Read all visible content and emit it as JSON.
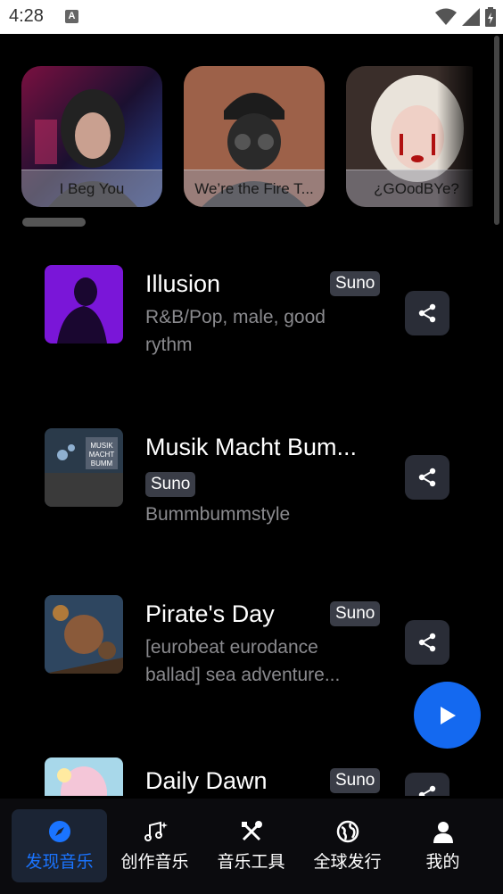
{
  "status_bar": {
    "time": "4:28",
    "notification_icon": "A"
  },
  "carousel": {
    "cards": [
      {
        "title": "I Beg You"
      },
      {
        "title": "We’re the Fire T..."
      },
      {
        "title": "¿GOodBYe?"
      }
    ]
  },
  "songs": [
    {
      "title": "Illusion",
      "badge": "Suno",
      "desc": "R&B/Pop, male, good rythm"
    },
    {
      "title": "Musik Macht Bum...",
      "badge": "Suno",
      "desc": "Bummbummstyle",
      "thumb_text": "MUSIK MACHT BUMM"
    },
    {
      "title": "Pirate's Day",
      "badge": "Suno",
      "desc": "[eurobeat eurodance ballad] sea adventure..."
    },
    {
      "title": "Daily Dawn",
      "badge": "Suno",
      "desc": ""
    }
  ],
  "nav": {
    "items": [
      {
        "label": "发现音乐",
        "icon": "compass-icon"
      },
      {
        "label": "创作音乐",
        "icon": "music-note-icon"
      },
      {
        "label": "音乐工具",
        "icon": "tools-icon"
      },
      {
        "label": "全球发行",
        "icon": "globe-icon"
      },
      {
        "label": "我的",
        "icon": "person-icon"
      }
    ]
  },
  "colors": {
    "accent": "#1469f0",
    "badge_bg": "#3a3d47",
    "share_bg": "#2a2d37",
    "background": "#000000"
  }
}
